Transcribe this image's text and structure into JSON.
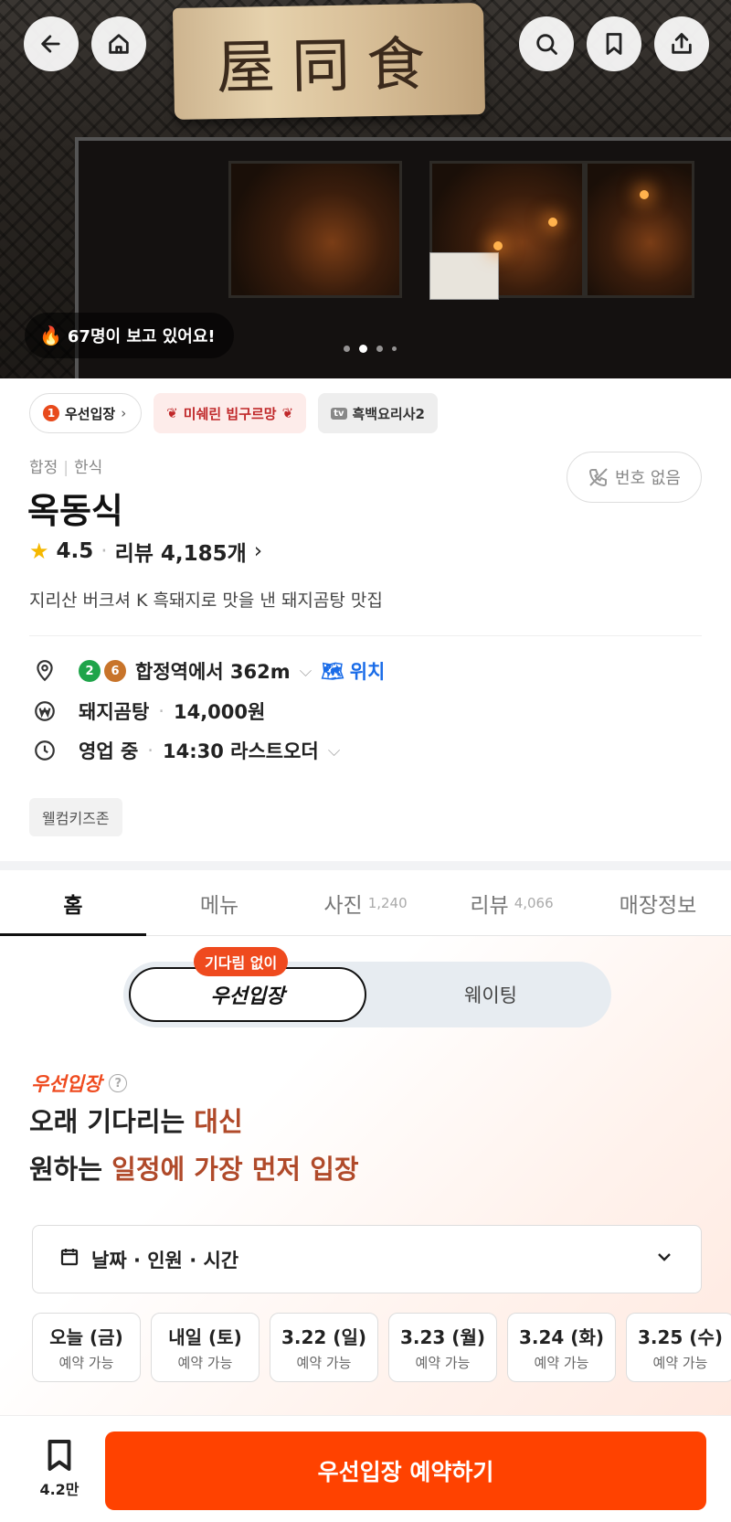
{
  "hero": {
    "sign_text": "屋同食",
    "viewers_text": "67명이 보고 있어요!",
    "carousel": {
      "count": 4,
      "active_index": 1
    }
  },
  "badges": {
    "priority_num": "1",
    "priority_label": "우선입장",
    "michelin_label": "미쉐린 빕구르망",
    "tv_icon": "tv",
    "tv_label": "흑백요리사2"
  },
  "store": {
    "area": "합정",
    "category": "한식",
    "name": "옥동식",
    "rating": "4.5",
    "review_label": "리뷰 4,185개",
    "description": "지리산 버크셔 K 흑돼지로 맛을 낸 돼지곰탕 맛집",
    "phone_label": "번호 없음"
  },
  "info": {
    "lines": [
      {
        "num": "2",
        "color": "#1fa44a"
      },
      {
        "num": "6",
        "color": "#c8742a"
      }
    ],
    "distance": "합정역에서 362m",
    "location_link": "위치",
    "menu_name": "돼지곰탕",
    "menu_price": "14,000원",
    "hours_status": "영업 중",
    "hours_detail": "14:30 라스트오더",
    "tag": "웰컴키즈존"
  },
  "tabs": [
    {
      "label": "홈",
      "count": ""
    },
    {
      "label": "메뉴",
      "count": ""
    },
    {
      "label": "사진",
      "count": "1,240"
    },
    {
      "label": "리뷰",
      "count": "4,066"
    },
    {
      "label": "매장정보",
      "count": ""
    }
  ],
  "promo": {
    "pill": "기다림 없이",
    "seg_on": "우선입장",
    "seg_off": "웨이팅",
    "title": "우선입장",
    "line1_a": "오래 기다리는 ",
    "line1_b": "대신",
    "line2_a": "원하는 ",
    "line2_b": "일정에 가장 먼저 입장",
    "select_label": "날짜 · 인원 · 시간"
  },
  "dates": [
    {
      "day": "오늘 (금)",
      "status": "예약 가능"
    },
    {
      "day": "내일 (토)",
      "status": "예약 가능"
    },
    {
      "day": "3.22 (일)",
      "status": "예약 가능"
    },
    {
      "day": "3.23 (월)",
      "status": "예약 가능"
    },
    {
      "day": "3.24 (화)",
      "status": "예약 가능"
    },
    {
      "day": "3.25 (수)",
      "status": "예약 가능"
    }
  ],
  "bottom": {
    "bookmark_count": "4.2만",
    "reserve_label": "우선입장 예약하기"
  },
  "colors": {
    "accent": "#ff4200",
    "link": "#1a6ce8",
    "michelin": "#c0282a"
  }
}
